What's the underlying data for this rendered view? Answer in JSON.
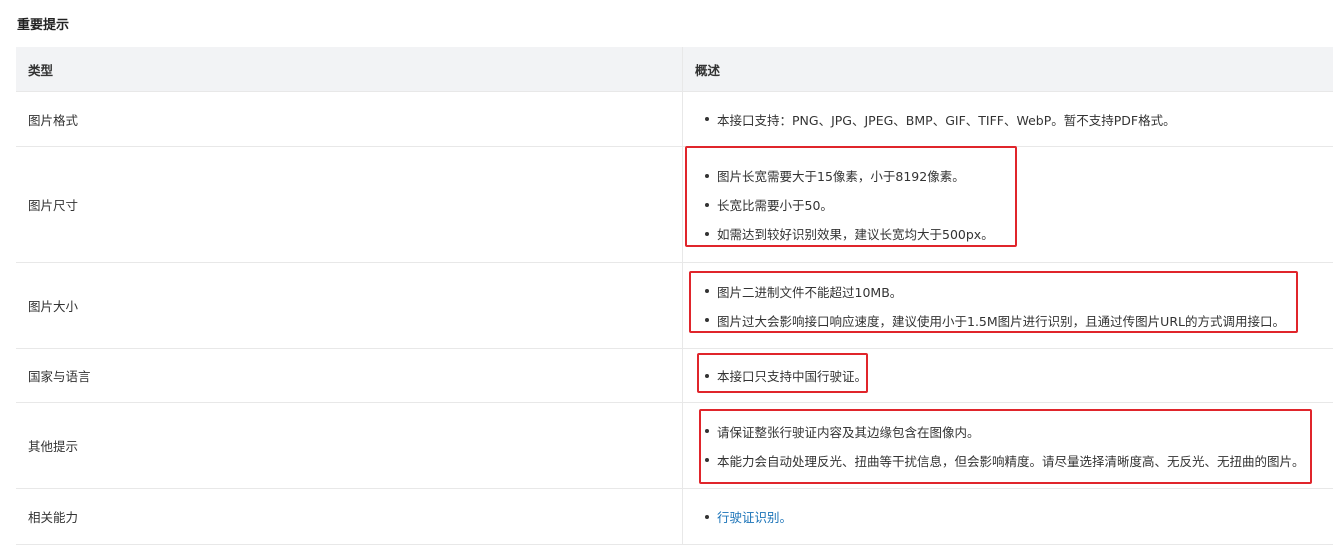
{
  "heading": "重要提示",
  "table": {
    "headers": {
      "type": "类型",
      "desc": "概述"
    },
    "rows": [
      {
        "type": "图片格式",
        "items": [
          "本接口支持：PNG、JPG、JPEG、BMP、GIF、TIFF、WebP。暂不支持PDF格式。"
        ]
      },
      {
        "type": "图片尺寸",
        "items": [
          "图片长宽需要大于15像素，小于8192像素。",
          "长宽比需要小于50。",
          "如需达到较好识别效果，建议长宽均大于500px。"
        ]
      },
      {
        "type": "图片大小",
        "items": [
          "图片二进制文件不能超过10MB。",
          "图片过大会影响接口响应速度，建议使用小于1.5M图片进行识别，且通过传图片URL的方式调用接口。"
        ]
      },
      {
        "type": "国家与语言",
        "items": [
          "本接口只支持中国行驶证。"
        ]
      },
      {
        "type": "其他提示",
        "items": [
          "请保证整张行驶证内容及其边缘包含在图像内。",
          "本能力会自动处理反光、扭曲等干扰信息，但会影响精度。请尽量选择清晰度高、无反光、无扭曲的图片。"
        ]
      },
      {
        "type": "相关能力",
        "items": [
          "行驶证识别。"
        ]
      }
    ]
  },
  "colors": {
    "highlight": "#e0252b",
    "link": "#1a73b8",
    "header_bg": "#f2f3f5"
  }
}
